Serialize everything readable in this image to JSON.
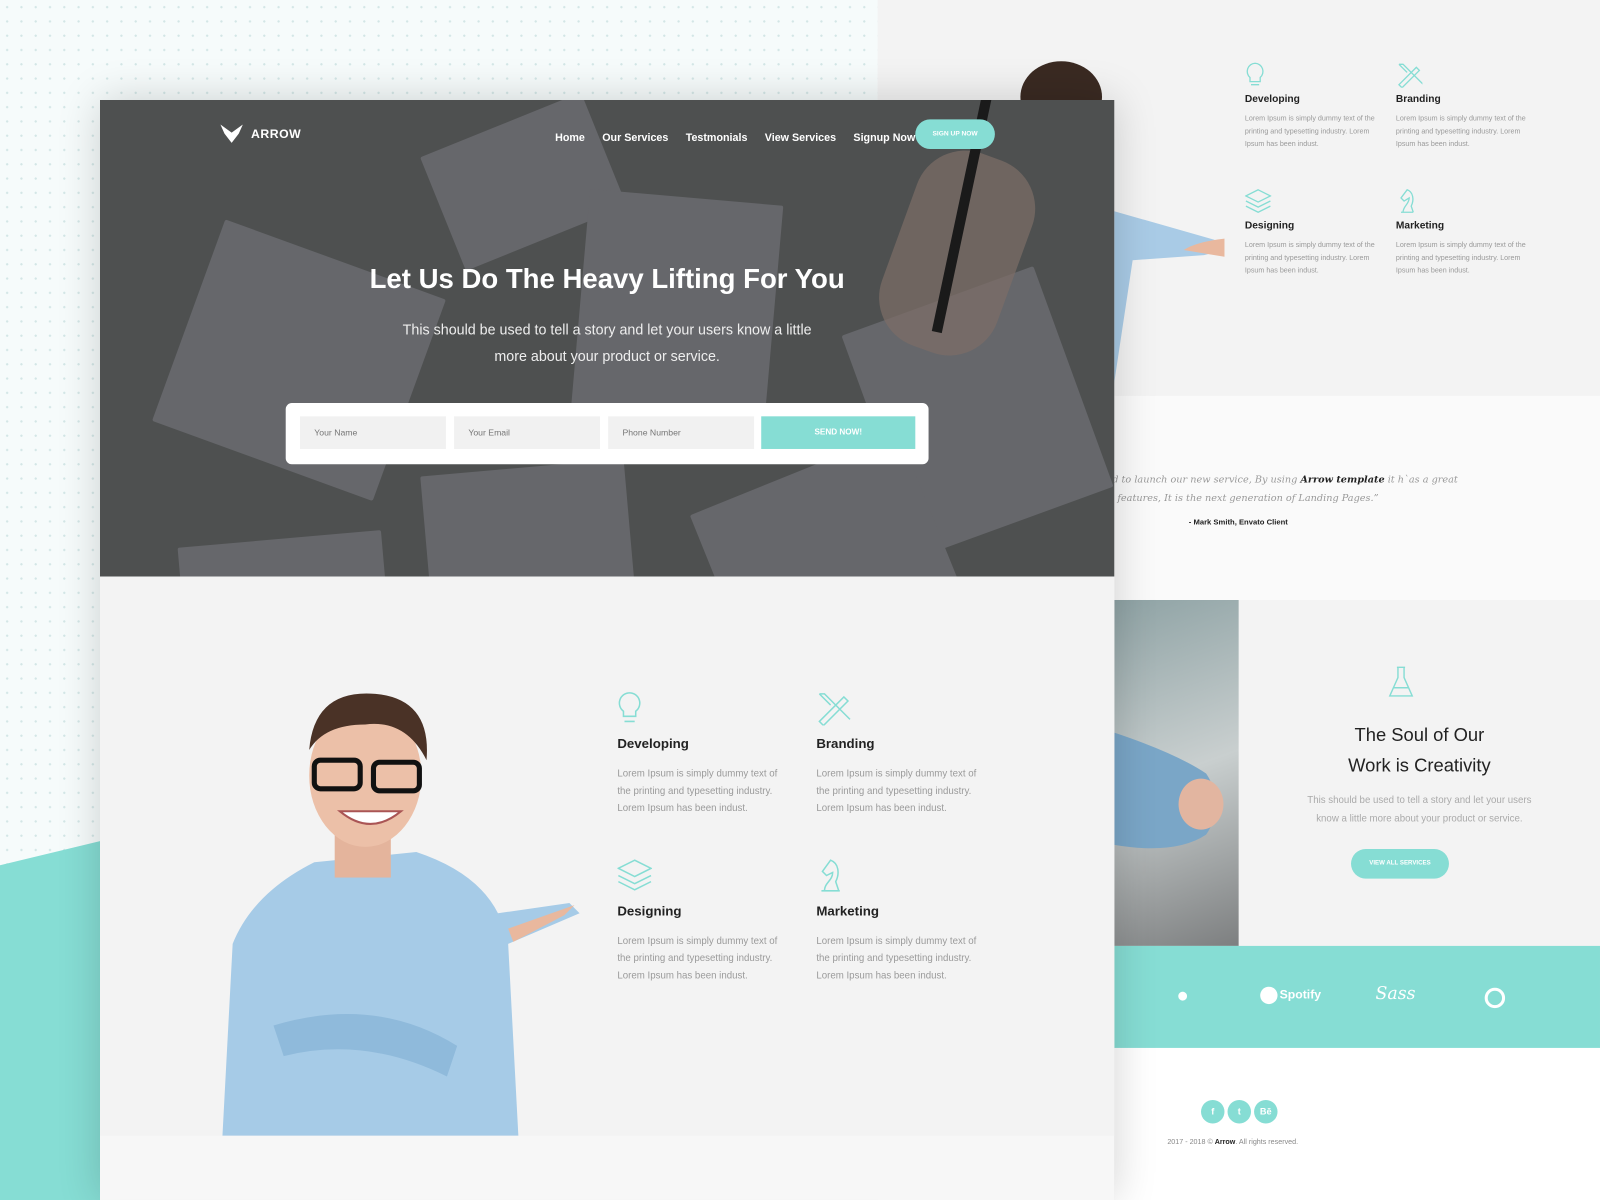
{
  "brand": {
    "name": "ARROW"
  },
  "nav": {
    "items": [
      "Home",
      "Our Services",
      "Testmonials",
      "View Services",
      "Signup Now"
    ],
    "cta": "SIGN UP NOW"
  },
  "hero": {
    "title": "Let Us Do The Heavy Lifting For You",
    "subtitle_line1": "This should be used to tell a story and let your users know a little",
    "subtitle_line2": "more about your product or service.",
    "form": {
      "name_placeholder": "Your Name",
      "email_placeholder": "Your Email",
      "phone_placeholder": "Phone Number",
      "submit": "SEND NOW!"
    }
  },
  "services": [
    {
      "icon": "lightbulb-icon",
      "title": "Developing",
      "line1": "Lorem Ipsum is simply dummy text of",
      "line2": "the printing and typesetting industry.",
      "line3": "Lorem Ipsum has been indust."
    },
    {
      "icon": "pencil-ruler-icon",
      "title": "Branding",
      "line1": "Lorem Ipsum is simply dummy text of",
      "line2": "the printing and typesetting industry.",
      "line3": "Lorem Ipsum has been indust."
    },
    {
      "icon": "layers-icon",
      "title": "Designing",
      "line1": "Lorem Ipsum is simply dummy text of",
      "line2": "the printing and typesetting industry.",
      "line3": "Lorem Ipsum has been indust."
    },
    {
      "icon": "chess-knight-icon",
      "title": "Marketing",
      "line1": "Lorem Ipsum is simply dummy text of",
      "line2": "the printing and typesetting industry.",
      "line3": "Lorem Ipsum has been indust."
    }
  ],
  "testimonial": {
    "line1_pre": "d to launch our new service, By using ",
    "line1_bold": "Arrow template",
    "line1_post": " it h`as a great",
    "line2": "features, It is the next generation of Landing Pages.”",
    "author": "- Mark Smith, Envato Client"
  },
  "creativity": {
    "title_line1": "The Soul of Our",
    "title_line2": "Work is Creativity",
    "text_line1": "This should be used to tell a story and let your users",
    "text_line2": "know a little more about your product or service.",
    "button": "VIEW ALL SERVICES"
  },
  "partners": {
    "spotify": "Spotify",
    "sass": "Sass",
    "icons": [
      "apple-icon",
      "spotify-icon",
      "sass-icon",
      "github-icon"
    ]
  },
  "footer": {
    "social": [
      "f",
      "t",
      "Bē"
    ],
    "copyright_pre": "2017 - 2018 © ",
    "copyright_brand": "Arrow",
    "copyright_post": ". All rights reserved."
  },
  "colors": {
    "accent": "#86ddd4",
    "hero_overlay": "#4e5050",
    "text_dark": "#222222"
  }
}
